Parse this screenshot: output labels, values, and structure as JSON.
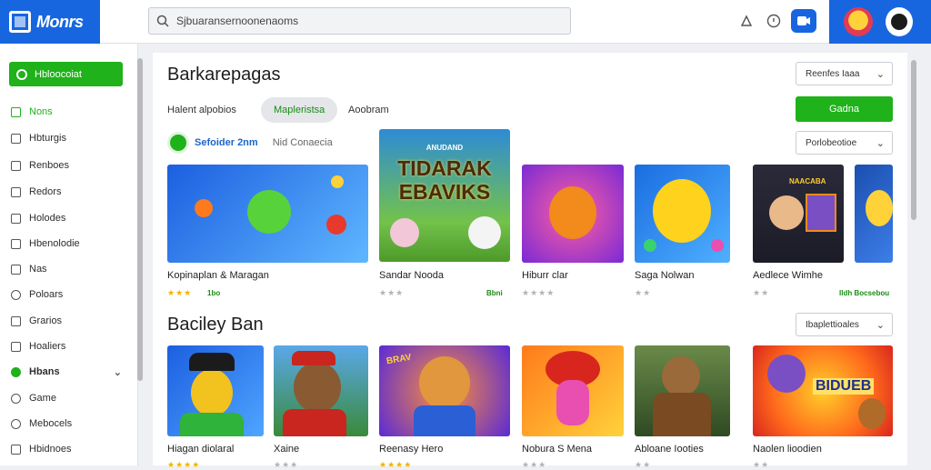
{
  "app": {
    "logo_text": "Monrs",
    "accent": "#1766e0",
    "green": "#1fb21a"
  },
  "search": {
    "value": "Sjbuaransernoonenaoms",
    "placeholder": "Sjbuaransernoonenaoms"
  },
  "header_icons": [
    "thumbs-icon",
    "info-icon",
    "video-badge-icon"
  ],
  "sidebar": {
    "primary_label": "Hbloocoiat",
    "items": [
      {
        "label": "Nons",
        "icon": "grid-icon",
        "style": "green"
      },
      {
        "label": "Hbturgis",
        "icon": "doc-icon"
      },
      {
        "label": "Renboes",
        "icon": "list-icon"
      },
      {
        "label": "Redors",
        "icon": "edit-icon"
      },
      {
        "label": "Holodes",
        "icon": "folder-icon"
      },
      {
        "label": "Hbenolodie",
        "icon": "file-icon"
      },
      {
        "label": "Nas",
        "icon": "square-icon"
      },
      {
        "label": "Poloars",
        "icon": "circle-icon"
      },
      {
        "label": "Grarios",
        "icon": "pencil-icon"
      },
      {
        "label": "Hoaliers",
        "icon": "chart-icon"
      },
      {
        "label": "Hbans",
        "icon": "toggle-icon",
        "style": "bold",
        "expandable": true
      },
      {
        "label": "Game",
        "icon": "gamepad-icon"
      },
      {
        "label": "Mebocels",
        "icon": "gear-icon"
      },
      {
        "label": "Hbidnoes",
        "icon": "box-icon"
      }
    ]
  },
  "section1": {
    "title": "Barkarepagas",
    "tabs": [
      "Halent alpobios",
      "Mapleristsa",
      "Aoobram"
    ],
    "active_tab": 1,
    "sort_dropdown": "Reenfes Iaaa",
    "green_button": "Gadna",
    "filter_dropdown": "Porlobeotioe",
    "brand_name": "Sefoider 2nm",
    "brand_sub": "Nid Conaecia",
    "cards": [
      {
        "title": "Kopinaplan & Maragan",
        "stars": "★★★",
        "rating_text": "1bo",
        "theme": "blue-bubble"
      },
      {
        "title": "Sandar Nooda",
        "stars": "★★★",
        "rating_text": "Bbni",
        "theme": "title-art",
        "art_text": "TIDARAK EBAVIKS",
        "art_top": "ANUDAND"
      },
      {
        "title": "Hiburr clar",
        "stars": "★★★★",
        "rating_text": "",
        "theme": "orange-bear"
      },
      {
        "title": "Saga Nolwan",
        "stars": "★★",
        "rating_text": "",
        "theme": "yellow-face"
      },
      {
        "title": "Aedlece Wimhe",
        "stars": "★★",
        "rating_text": "Ildh Bocsebou",
        "theme": "robot-sign",
        "art_text": "NAACABA"
      }
    ]
  },
  "section2": {
    "title": "Baciley Ban",
    "dropdown": "Ibaplettioales",
    "cards": [
      {
        "title": "Hiagan diolaral",
        "stars": "★★★★",
        "theme": "green-cap"
      },
      {
        "title": "Xaine",
        "stars": "★★★",
        "theme": "red-bear"
      },
      {
        "title": "Reenasy Hero",
        "stars": "★★★★",
        "theme": "brave-bear",
        "art_text": "BRAV"
      },
      {
        "title": "Nobura S Mena",
        "stars": "★★★",
        "theme": "pink-creature"
      },
      {
        "title": "Abloane Iooties",
        "stars": "★★",
        "theme": "wolf-forest"
      },
      {
        "title": "Naolen lioodien",
        "stars": "★★",
        "theme": "fox-sign",
        "art_text": "BIDUEB"
      }
    ]
  }
}
